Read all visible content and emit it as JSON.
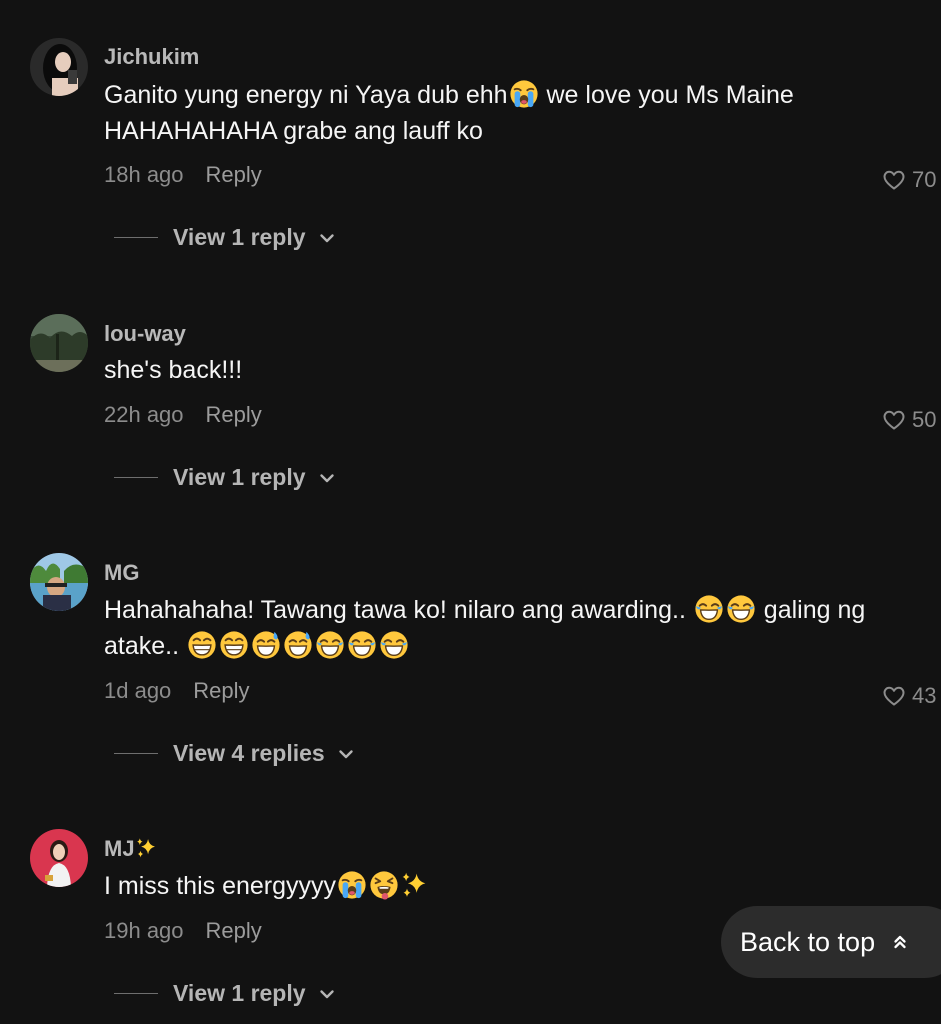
{
  "comments": [
    {
      "username": "Jichukim",
      "text_a": "Ganito yung energy ni Yaya dub ehh",
      "text_b": " we love you Ms Maine HAHAHAHAHA grabe ang lauff ko",
      "time": "18h ago",
      "reply_label": "Reply",
      "likes": "70",
      "view_replies": "View 1 reply"
    },
    {
      "username": "lou-way",
      "text": "she's back!!!",
      "time": "22h ago",
      "reply_label": "Reply",
      "likes": "50",
      "view_replies": "View 1 reply"
    },
    {
      "username": "MG",
      "text_a": "Hahahahaha! Tawang tawa ko! nilaro ang awarding.. ",
      "text_b": " galing ng atake.. ",
      "time": "1d ago",
      "reply_label": "Reply",
      "likes": "43",
      "view_replies": "View 4 replies"
    },
    {
      "username": "MJ",
      "text_a": "I miss this energyyyy",
      "time": "19h ago",
      "reply_label": "Reply",
      "view_replies": "View 1 reply"
    }
  ],
  "back_to_top": {
    "label": "Back to top"
  },
  "icons": {
    "heart": "heart-outline-icon",
    "chevron": "chevron-down-icon",
    "back_to_top": "double-chevron-up-icon"
  },
  "colors": {
    "background": "#121212",
    "username": "#b9b9b9",
    "text": "#f5f5f5",
    "meta": "#8c8c8c",
    "button": "#2c2c2c"
  }
}
